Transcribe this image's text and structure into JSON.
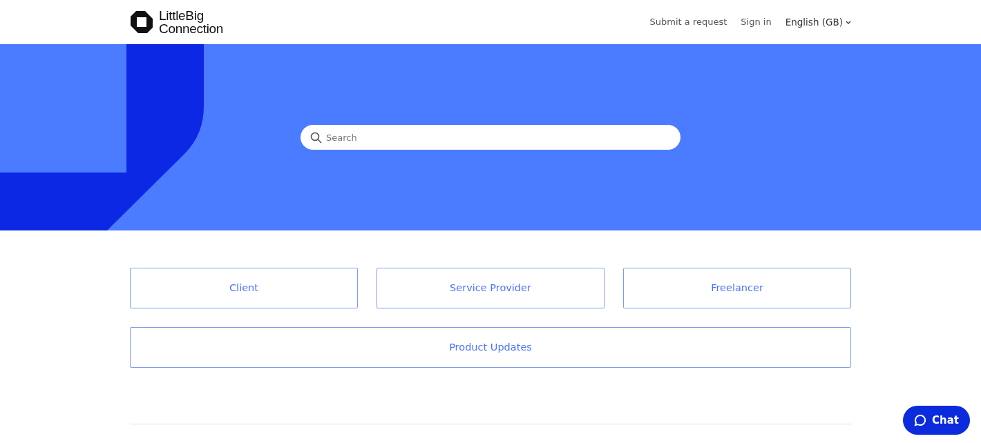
{
  "header": {
    "logo_line_1": "LittleBig",
    "logo_line_2": "Connection",
    "links": [
      "Submit a request",
      "Sign in"
    ],
    "language": "English (GB)"
  },
  "search": {
    "placeholder": "Search"
  },
  "categories": [
    {
      "label": "Client",
      "wide": false
    },
    {
      "label": "Service Provider",
      "wide": false
    },
    {
      "label": "Freelancer",
      "wide": false
    },
    {
      "label": "Product Updates",
      "wide": true
    }
  ],
  "chat_button": {
    "label": "Chat"
  }
}
